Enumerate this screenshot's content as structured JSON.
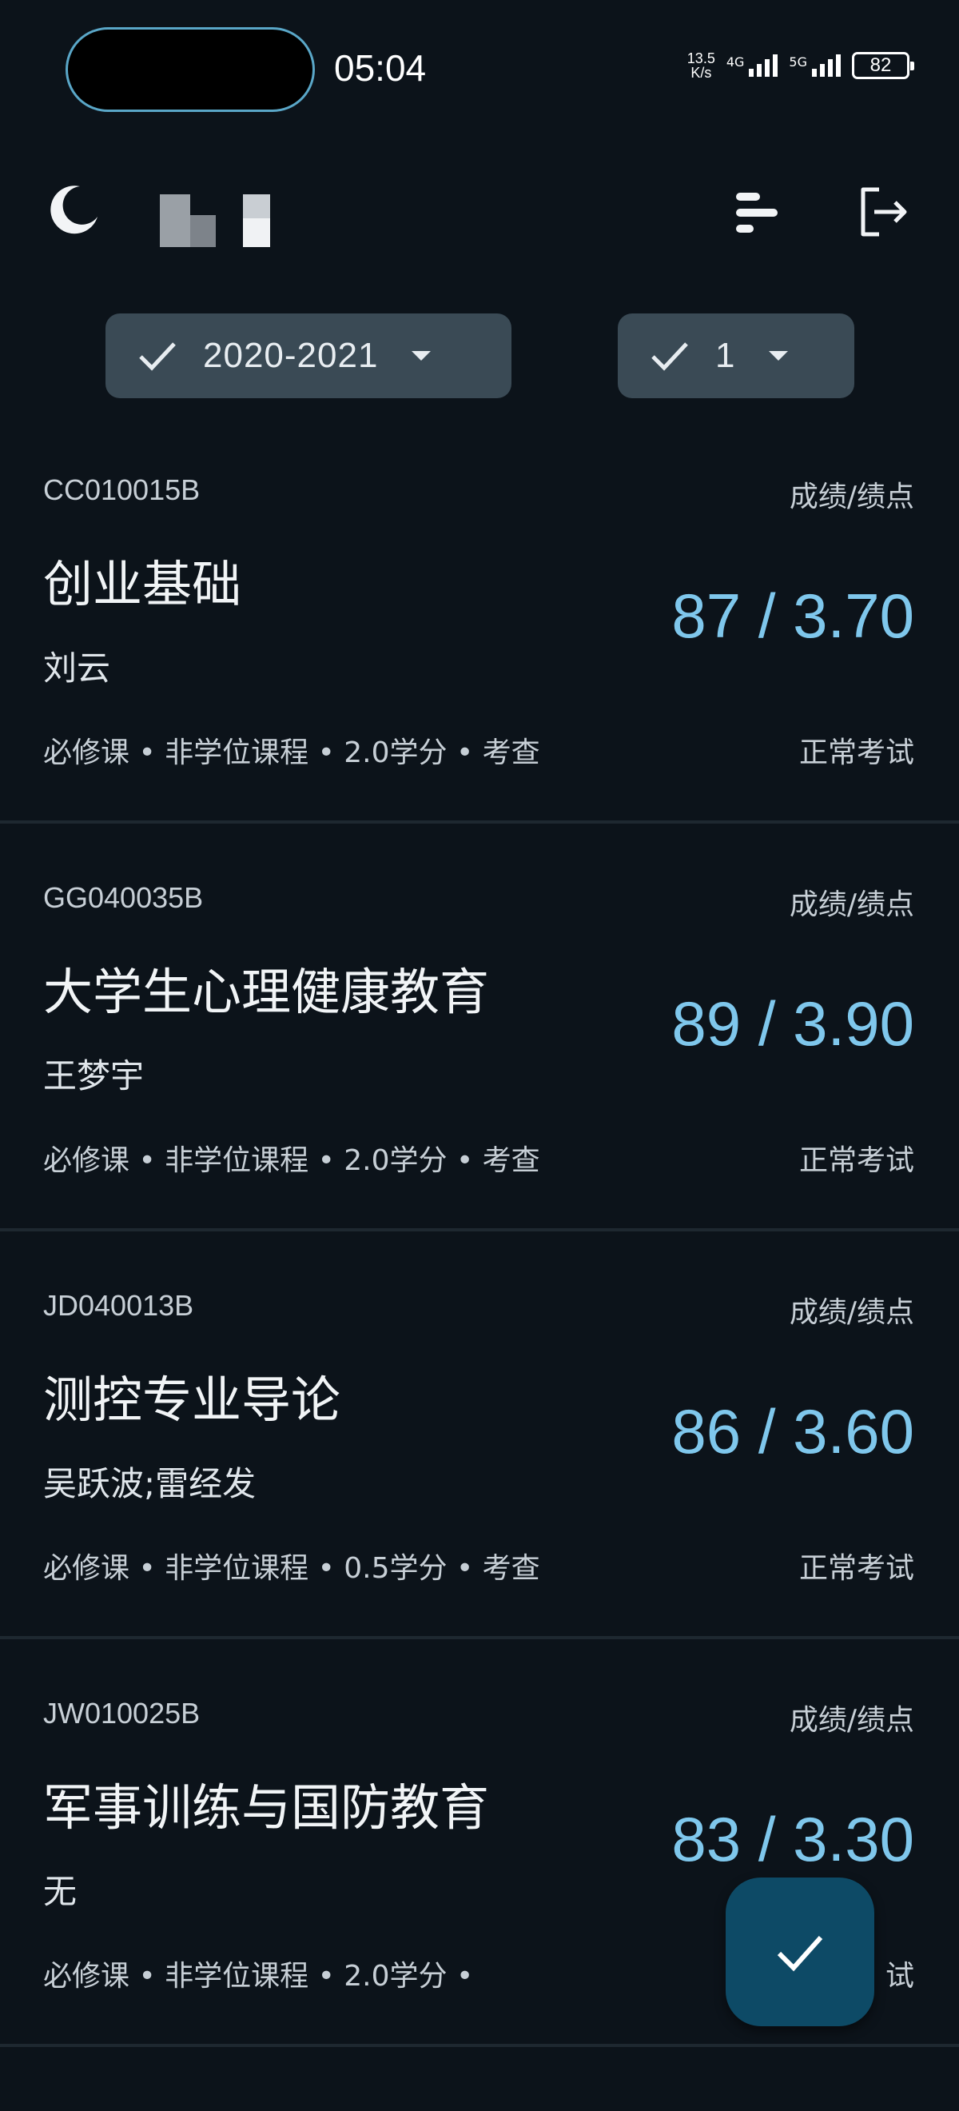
{
  "status_bar": {
    "time": "05:04",
    "net_speed_value": "13.5",
    "net_speed_unit": "K/s",
    "sim1_label": "4G",
    "sim2_label": "5G",
    "battery": "82"
  },
  "app_bar": {
    "icons": [
      "moon-icon",
      "sort-icon",
      "logout-icon"
    ]
  },
  "filters": {
    "year": "2020-2021",
    "term": "1"
  },
  "courses": [
    {
      "code": "CC010015B",
      "score_label": "成绩/绩点",
      "name": "创业基础",
      "teacher": "刘云",
      "score": "87 / 3.70",
      "meta": "必修课 • 非学位课程 • 2.0学分 • 考查",
      "exam": "正常考试"
    },
    {
      "code": "GG040035B",
      "score_label": "成绩/绩点",
      "name": "大学生心理健康教育",
      "teacher": "王梦宇",
      "score": "89 / 3.90",
      "meta": "必修课 • 非学位课程 • 2.0学分 • 考查",
      "exam": "正常考试"
    },
    {
      "code": "JD040013B",
      "score_label": "成绩/绩点",
      "name": "测控专业导论",
      "teacher": "吴跃波;雷经发",
      "score": "86 / 3.60",
      "meta": "必修课 • 非学位课程 • 0.5学分 • 考查",
      "exam": "正常考试"
    },
    {
      "code": "JW010025B",
      "score_label": "成绩/绩点",
      "name": "军事训练与国防教育",
      "teacher": "无",
      "score": "83 / 3.30",
      "meta": "必修课 • 非学位课程 • 2.0学分 •",
      "exam": "试"
    }
  ],
  "colors": {
    "background": "#0c131a",
    "accent_score": "#7fc7ec",
    "chip_bg": "#3a4a55",
    "fab_bg": "#0d4a66"
  }
}
